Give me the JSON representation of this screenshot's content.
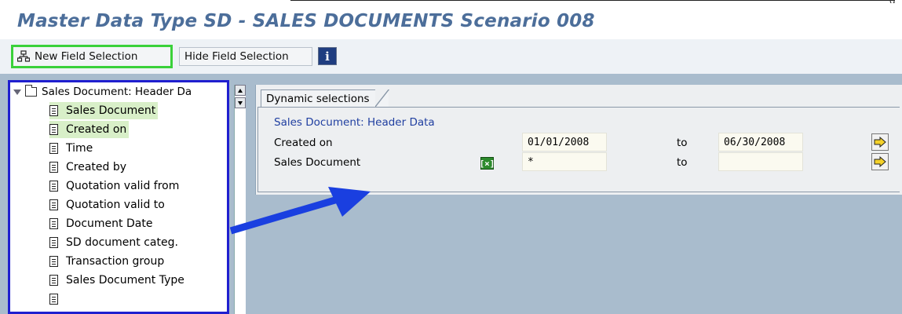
{
  "header": {
    "title": "Master Data Type SD - SALES DOCUMENTS Scenario 008",
    "corner_text": "g"
  },
  "toolbar": {
    "new_field_selection": "New Field Selection",
    "hide_field_selection": "Hide Field Selection",
    "info_label": "i"
  },
  "tree": {
    "root_label": "Sales Document: Header Da",
    "items": [
      {
        "label": "Sales Document",
        "highlighted": true
      },
      {
        "label": "Created on",
        "highlighted": true
      },
      {
        "label": "Time",
        "highlighted": false
      },
      {
        "label": "Created by",
        "highlighted": false
      },
      {
        "label": "Quotation valid from",
        "highlighted": false
      },
      {
        "label": "Quotation valid to",
        "highlighted": false
      },
      {
        "label": "Document Date",
        "highlighted": false
      },
      {
        "label": "SD document categ.",
        "highlighted": false
      },
      {
        "label": "Transaction group",
        "highlighted": false
      },
      {
        "label": "Sales Document Type",
        "highlighted": false
      }
    ]
  },
  "dynamic": {
    "tab_label": "Dynamic selections",
    "group_label": "Sales Document: Header Data",
    "rows": [
      {
        "label": "Created on",
        "from": "01/01/2008",
        "to_label": "to",
        "to": "06/30/2008"
      },
      {
        "label": "Sales Document",
        "from": "*",
        "to_label": "to",
        "to": ""
      }
    ],
    "selection_icon_text": "[×]"
  },
  "colors": {
    "title": "#4c6e9a",
    "highlight": "#d8efc8",
    "tree_border": "#1f1fcf",
    "button_border": "#3ad13a",
    "background": "#a9bccd",
    "group_label": "#1f3ea0"
  }
}
